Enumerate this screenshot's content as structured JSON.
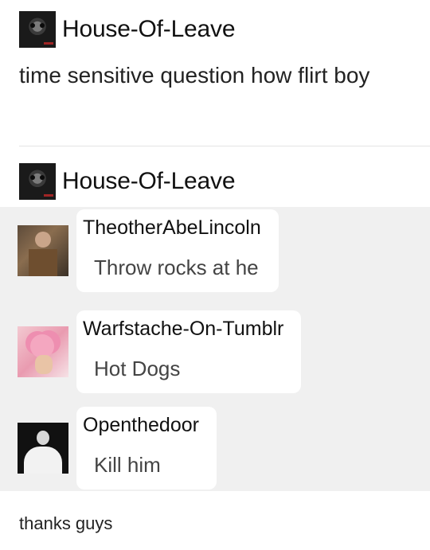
{
  "post": {
    "username": "House-Of-Leave",
    "body": "time sensitive question how flirt boy"
  },
  "reblog": {
    "username": "House-Of-Leave"
  },
  "replies": [
    {
      "username": "TheotherAbeLincoln",
      "text": "Throw rocks at he",
      "avatar": "lincoln-avatar"
    },
    {
      "username": "Warfstache-On-Tumblr",
      "text": "Hot Dogs",
      "avatar": "pink-hair-avatar"
    },
    {
      "username": "Openthedoor",
      "text": "Kill him",
      "avatar": "white-suit-avatar"
    }
  ],
  "footer": {
    "text": "thanks guys"
  }
}
